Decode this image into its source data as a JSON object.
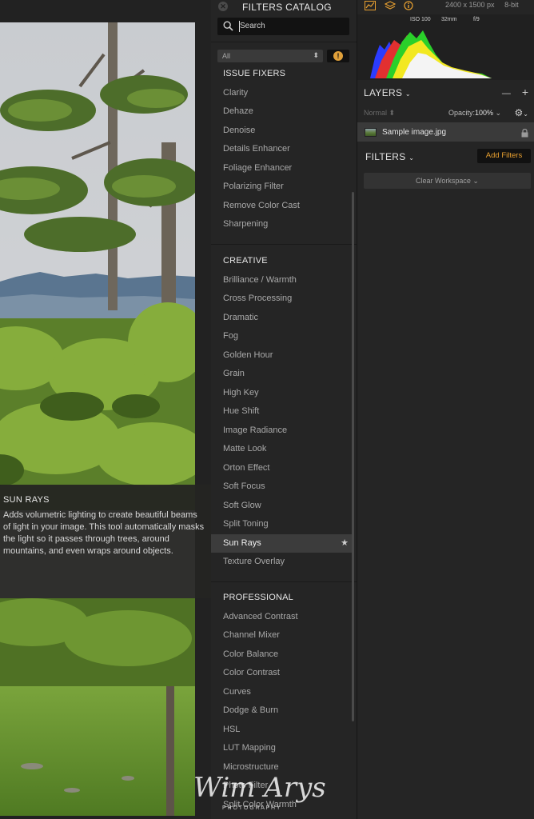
{
  "tooltip": {
    "title": "SUN RAYS",
    "body": "Adds volumetric lighting to create beautiful beams of light in your image. This tool automatically masks the light so it passes through trees, around mountains, and even wraps around objects."
  },
  "catalog": {
    "title": "FILTERS CATALOG",
    "search_placeholder": "Search",
    "category_select": "All",
    "sections": [
      {
        "title": "ISSUE FIXERS",
        "items": [
          "Clarity",
          "Dehaze",
          "Denoise",
          "Details Enhancer",
          "Foliage Enhancer",
          "Polarizing Filter",
          "Remove Color Cast",
          "Sharpening"
        ]
      },
      {
        "title": "CREATIVE",
        "items": [
          "Brilliance / Warmth",
          "Cross Processing",
          "Dramatic",
          "Fog",
          "Golden Hour",
          "Grain",
          "High Key",
          "Hue Shift",
          "Image Radiance",
          "Matte Look",
          "Orton Effect",
          "Soft Focus",
          "Soft Glow",
          "Split Toning",
          "Sun Rays",
          "Texture Overlay"
        ]
      },
      {
        "title": "PROFESSIONAL",
        "items": [
          "Advanced Contrast",
          "Channel Mixer",
          "Color Balance",
          "Color Contrast",
          "Curves",
          "Dodge & Burn",
          "HSL",
          "LUT Mapping",
          "Microstructure",
          "Photo Filter",
          "Split Color Warmth"
        ]
      }
    ],
    "active_item": "Sun Rays",
    "icons": {
      "close": "close-circle-icon",
      "search": "magnifier-icon",
      "favorite": "star-icon",
      "select_arrow": "up-down-chevron-icon",
      "info": "info-circle-icon"
    }
  },
  "right_panel": {
    "image_size": "2400 x 1500 px",
    "bit_depth": "8-bit",
    "exif": {
      "iso": "ISO 100",
      "focal": "32mm",
      "aperture": "f/9"
    },
    "layers": {
      "title": "LAYERS",
      "blend_mode": "Normal",
      "opacity_label": "Opacity:",
      "opacity_value": "100%",
      "layer_name": "Sample image.jpg",
      "add": "+",
      "remove": "—"
    },
    "filters": {
      "title": "FILTERS",
      "add_button": "Add Filters",
      "clear_workspace": "Clear Workspace"
    },
    "top_icons": [
      "histogram-icon",
      "layers-icon",
      "info-icon"
    ],
    "accent_color": "#e8a030"
  },
  "watermark": {
    "script": "Wim Arys",
    "spaced": "P H O T O G R A P H Y"
  }
}
